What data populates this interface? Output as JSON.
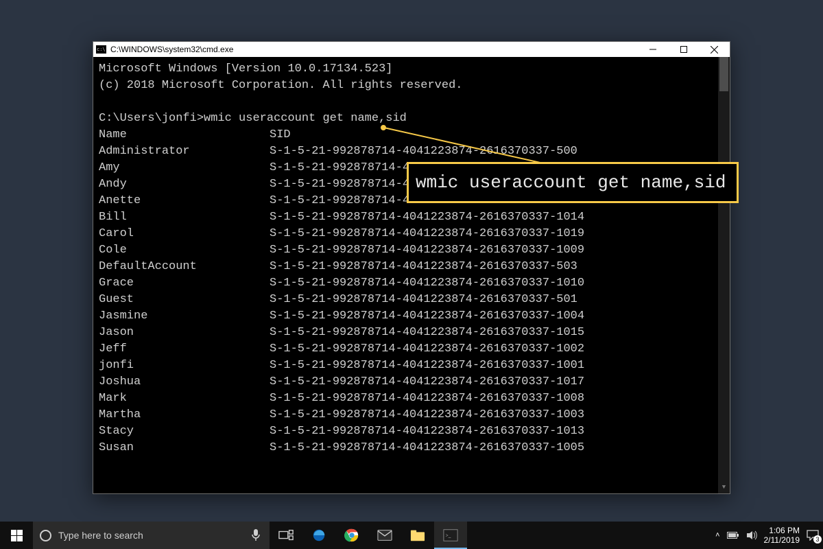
{
  "window": {
    "title": "C:\\WINDOWS\\system32\\cmd.exe"
  },
  "terminal": {
    "banner1": "Microsoft Windows [Version 10.0.17134.523]",
    "banner2": "(c) 2018 Microsoft Corporation. All rights reserved.",
    "prompt": "C:\\Users\\jonfi>",
    "command": "wmic useraccount get name,sid",
    "header": {
      "name": "Name",
      "sid": "SID"
    },
    "rows": [
      {
        "name": "Administrator",
        "sid": "S-1-5-21-992878714-4041223874-2616370337-500"
      },
      {
        "name": "Amy",
        "sid": "S-1-5-21-992878714-4041223874-2616370337-1012"
      },
      {
        "name": "Andy",
        "sid": "S-1-5-21-992878714-4041223874-2616370337-1016"
      },
      {
        "name": "Anette",
        "sid": "S-1-5-21-992878714-4041223874-2616370337-1018"
      },
      {
        "name": "Bill",
        "sid": "S-1-5-21-992878714-4041223874-2616370337-1014"
      },
      {
        "name": "Carol",
        "sid": "S-1-5-21-992878714-4041223874-2616370337-1019"
      },
      {
        "name": "Cole",
        "sid": "S-1-5-21-992878714-4041223874-2616370337-1009"
      },
      {
        "name": "DefaultAccount",
        "sid": "S-1-5-21-992878714-4041223874-2616370337-503"
      },
      {
        "name": "Grace",
        "sid": "S-1-5-21-992878714-4041223874-2616370337-1010"
      },
      {
        "name": "Guest",
        "sid": "S-1-5-21-992878714-4041223874-2616370337-501"
      },
      {
        "name": "Jasmine",
        "sid": "S-1-5-21-992878714-4041223874-2616370337-1004"
      },
      {
        "name": "Jason",
        "sid": "S-1-5-21-992878714-4041223874-2616370337-1015"
      },
      {
        "name": "Jeff",
        "sid": "S-1-5-21-992878714-4041223874-2616370337-1002"
      },
      {
        "name": "jonfi",
        "sid": "S-1-5-21-992878714-4041223874-2616370337-1001"
      },
      {
        "name": "Joshua",
        "sid": "S-1-5-21-992878714-4041223874-2616370337-1017"
      },
      {
        "name": "Mark",
        "sid": "S-1-5-21-992878714-4041223874-2616370337-1008"
      },
      {
        "name": "Martha",
        "sid": "S-1-5-21-992878714-4041223874-2616370337-1003"
      },
      {
        "name": "Stacy",
        "sid": "S-1-5-21-992878714-4041223874-2616370337-1013"
      },
      {
        "name": "Susan",
        "sid": "S-1-5-21-992878714-4041223874-2616370337-1005"
      }
    ]
  },
  "callout": {
    "text": "wmic useraccount get name,sid"
  },
  "taskbar": {
    "search_placeholder": "Type here to search",
    "time": "1:06 PM",
    "date": "2/11/2019",
    "notif_count": "3"
  }
}
